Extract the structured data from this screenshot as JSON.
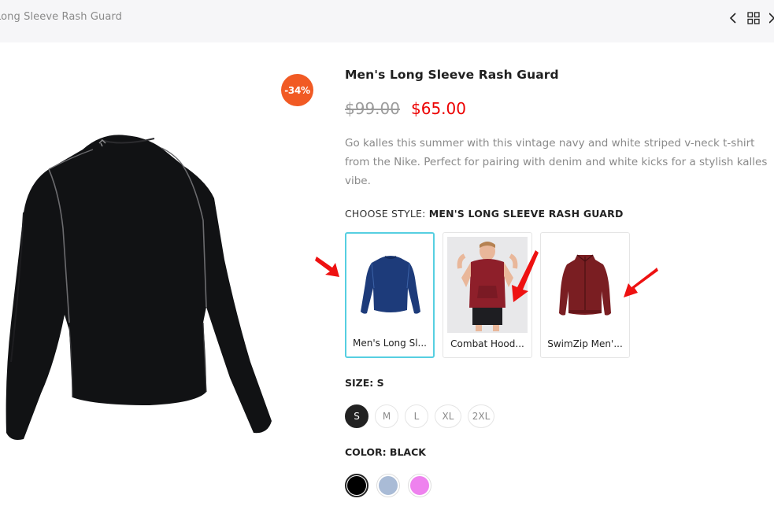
{
  "breadcrumb": "Long Sleeve Rash Guard",
  "icons": {
    "prev": "chevron-left-icon",
    "grid": "grid-icon",
    "next": "chevron-right-icon"
  },
  "badge": "-34%",
  "product": {
    "title": "Men's Long Sleeve Rash Guard",
    "price_old": "$99.00",
    "price_new": "$65.00",
    "description": "Go kalles this summer with this vintage navy and white striped v-neck t-shirt from the Nike. Perfect for pairing with denim and white kicks for a stylish kalles vibe."
  },
  "style": {
    "label": "CHOOSE STYLE:",
    "value": "MEN'S LONG SLEEVE RASH GUARD",
    "options": [
      {
        "label": "Men's Long Sl...",
        "selected": true
      },
      {
        "label": "Combat Hood...",
        "selected": false
      },
      {
        "label": "SwimZip Men'...",
        "selected": false
      }
    ]
  },
  "size": {
    "label": "SIZE: S",
    "options": [
      "S",
      "M",
      "L",
      "XL",
      "2XL"
    ],
    "selected": "S"
  },
  "color": {
    "label": "COLOR: BLACK",
    "options": [
      {
        "name": "Black",
        "hex": "#000000",
        "selected": true
      },
      {
        "name": "Light Blue",
        "hex": "#a9bbd6",
        "selected": false
      },
      {
        "name": "Pink",
        "hex": "#ee82ee",
        "selected": false
      }
    ]
  },
  "colors": {
    "accent_border": "#56cfe1",
    "sale_price": "#ec0101",
    "badge_bg": "#f15a24",
    "annotation_arrow": "#ee1111"
  }
}
